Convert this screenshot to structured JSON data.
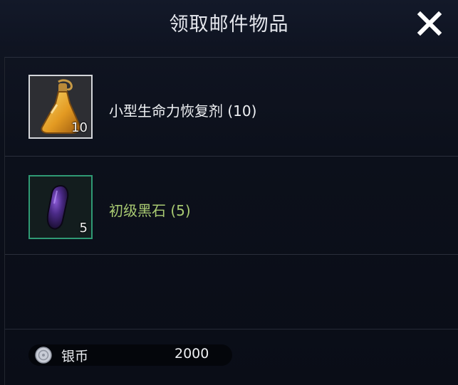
{
  "dialog": {
    "title": "领取邮件物品",
    "close_icon": "close-x-icon"
  },
  "items": [
    {
      "icon": "potion-bottle-icon",
      "rarity_color": "#d4d6da",
      "quantity": "10",
      "name": "小型生命力恢复剂 (10)"
    },
    {
      "icon": "black-stone-icon",
      "rarity_color": "#2f9a74",
      "quantity": "5",
      "name": "初级黑石 (5)"
    }
  ],
  "currency": {
    "icon": "silver-coin-icon",
    "label": "银币",
    "amount": "2000"
  }
}
